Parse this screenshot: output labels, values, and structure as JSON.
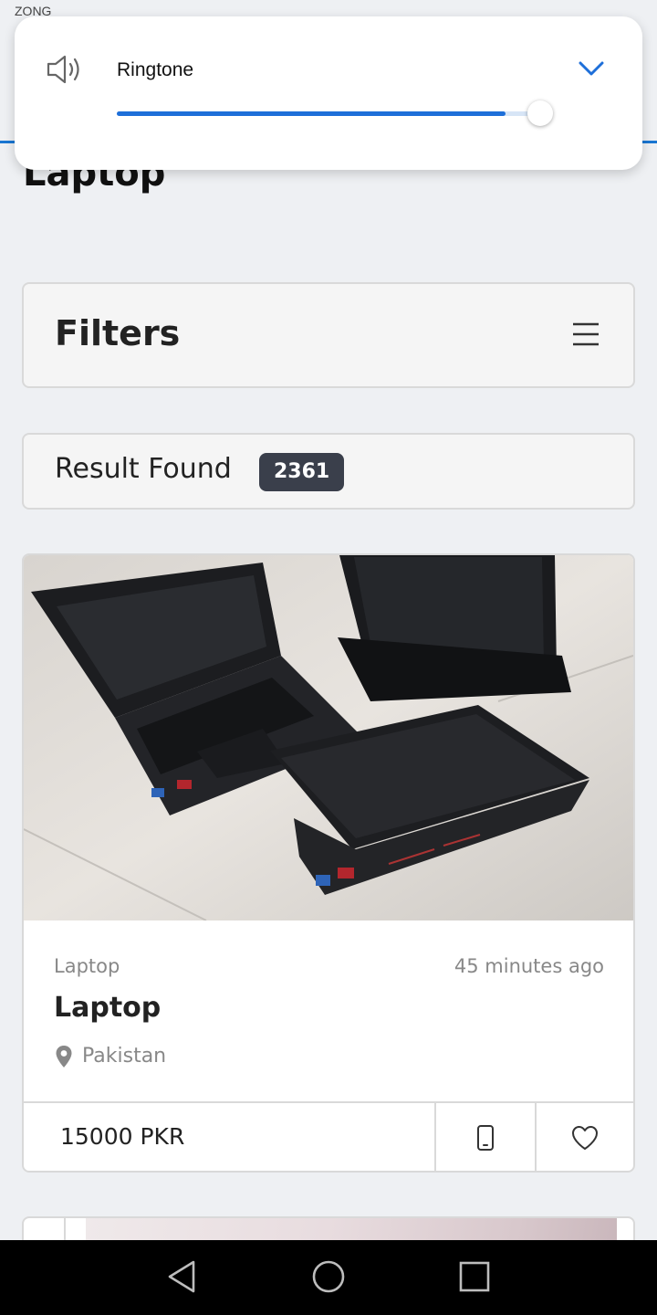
{
  "status_bar": {
    "carrier": "ZONG"
  },
  "volume_panel": {
    "label": "Ringtone",
    "level": 0.9,
    "icons": {
      "speaker": "speaker-icon",
      "expand": "chevron-down-icon"
    },
    "accent_color": "#1e6fd9"
  },
  "page": {
    "title": "Laptop"
  },
  "filters": {
    "title": "Filters",
    "icon": "menu-icon"
  },
  "results": {
    "label": "Result Found",
    "count": "2361"
  },
  "listings": [
    {
      "category": "Laptop",
      "time": "45 minutes ago",
      "title": "Laptop",
      "location": "Pakistan",
      "price": "15000 PKR",
      "icons": {
        "location": "map-pin-icon",
        "call": "phone-icon",
        "favorite": "heart-icon"
      }
    }
  ],
  "nav": {
    "icons": [
      "back-icon",
      "home-icon",
      "recents-icon"
    ]
  }
}
